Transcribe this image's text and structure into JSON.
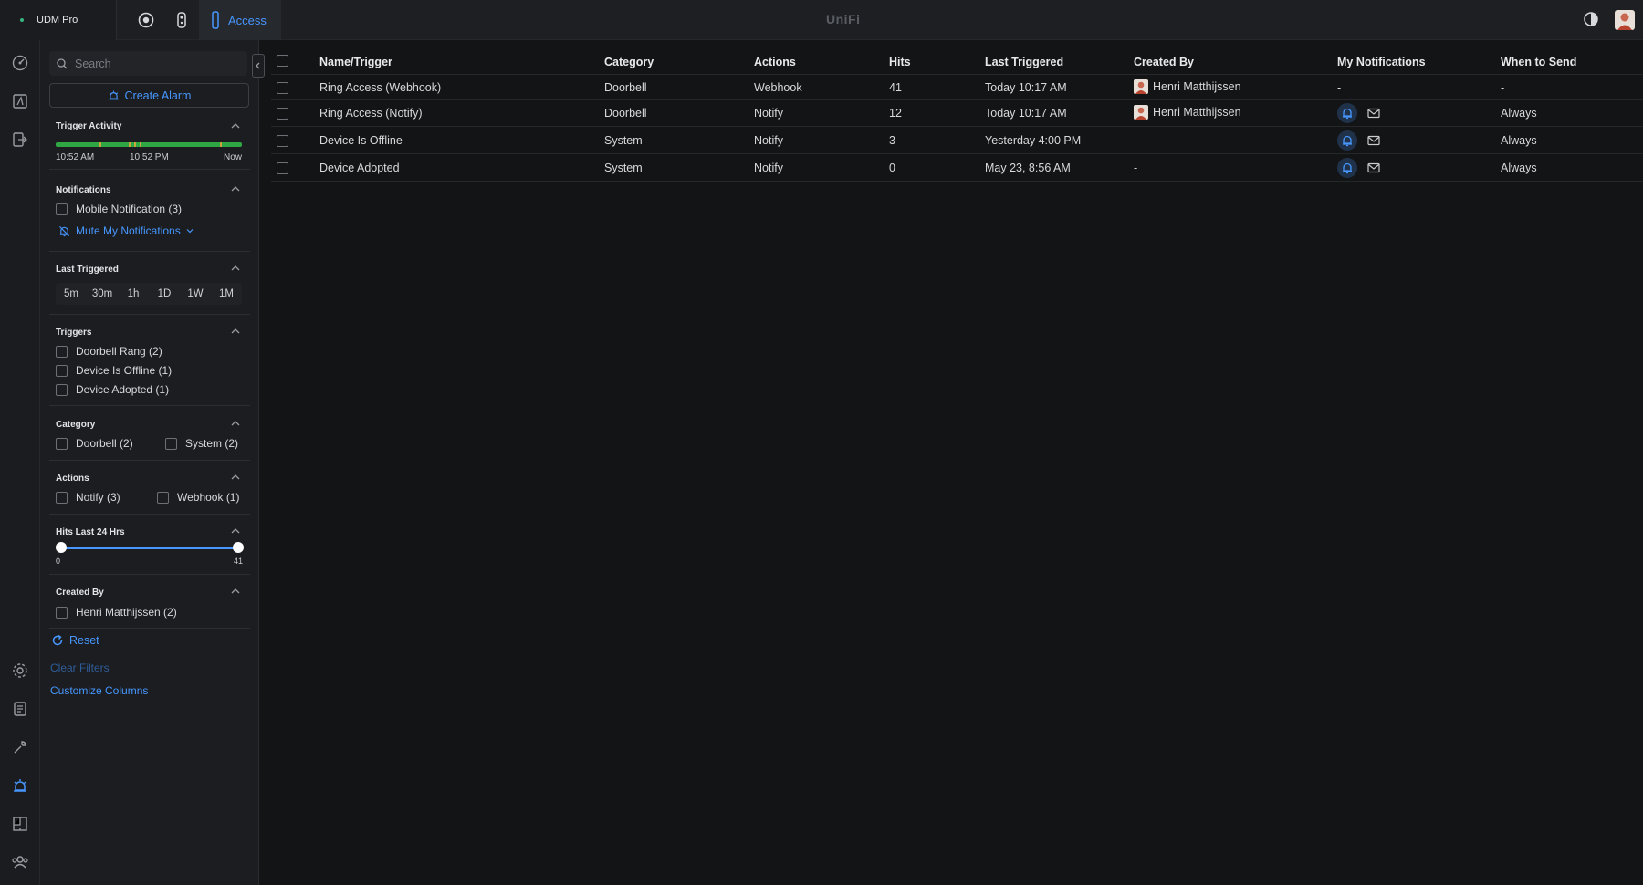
{
  "topbar": {
    "device_name": "UDM Pro",
    "app_tab_label": "Access",
    "brand": "UniFi"
  },
  "sidebar": {
    "search_placeholder": "Search",
    "create_alarm_label": "Create Alarm",
    "trigger_activity": {
      "title": "Trigger Activity",
      "times": [
        "10:52 AM",
        "10:52 PM",
        "Now"
      ]
    },
    "notifications": {
      "title": "Notifications",
      "mobile_label": "Mobile Notification (3)",
      "mute_label": "Mute My Notifications"
    },
    "last_triggered": {
      "title": "Last Triggered",
      "options": [
        "5m",
        "30m",
        "1h",
        "1D",
        "1W",
        "1M"
      ]
    },
    "triggers": {
      "title": "Triggers",
      "items": [
        "Doorbell Rang (2)",
        "Device Is Offline (1)",
        "Device Adopted (1)"
      ]
    },
    "category": {
      "title": "Category",
      "items": [
        "Doorbell (2)",
        "System (2)"
      ]
    },
    "actions": {
      "title": "Actions",
      "items": [
        "Notify (3)",
        "Webhook (1)"
      ]
    },
    "hits": {
      "title": "Hits Last 24 Hrs",
      "min": "0",
      "max": "41"
    },
    "created_by": {
      "title": "Created By",
      "items": [
        "Henri Matthijssen (2)"
      ]
    },
    "reset_label": "Reset",
    "clear_filters_label": "Clear Filters",
    "customize_columns_label": "Customize Columns"
  },
  "table": {
    "headers": [
      "Name/Trigger",
      "Category",
      "Actions",
      "Hits",
      "Last Triggered",
      "Created By",
      "My Notifications",
      "When to Send"
    ],
    "rows": [
      {
        "name": "Ring Access (Webhook)",
        "category": "Doorbell",
        "action": "Webhook",
        "hits": "41",
        "last": "Today 10:17 AM",
        "creator": "Henri Matthijssen",
        "notif": "-",
        "when": "-"
      },
      {
        "name": "Ring Access (Notify)",
        "category": "Doorbell",
        "action": "Notify",
        "hits": "12",
        "last": "Today 10:17 AM",
        "creator": "Henri Matthijssen",
        "notif": "",
        "when": "Always"
      },
      {
        "name": "Device Is Offline",
        "category": "System",
        "action": "Notify",
        "hits": "3",
        "last": "Yesterday 4:00 PM",
        "creator": "-",
        "notif": "",
        "when": "Always"
      },
      {
        "name": "Device Adopted",
        "category": "System",
        "action": "Notify",
        "hits": "0",
        "last": "May 23, 8:56 AM",
        "creator": "-",
        "notif": "",
        "when": "Always"
      }
    ]
  },
  "colors": {
    "accent": "#4797ff",
    "background": "#131416",
    "panel": "#1b1d20",
    "activity_green": "#2fa844"
  },
  "icons": [
    "unifi-icon",
    "camera-icon",
    "doorbell-icon",
    "shield-icon",
    "theme-icon",
    "dashboard-icon",
    "topology-icon",
    "devices-icon",
    "settings-icon",
    "logs-icon",
    "tools-icon",
    "alarm-icon",
    "floorplan-icon",
    "users-icon",
    "search-icon",
    "alarm-create-icon",
    "bell-off-icon",
    "bell-icon",
    "mail-icon",
    "reset-icon"
  ]
}
